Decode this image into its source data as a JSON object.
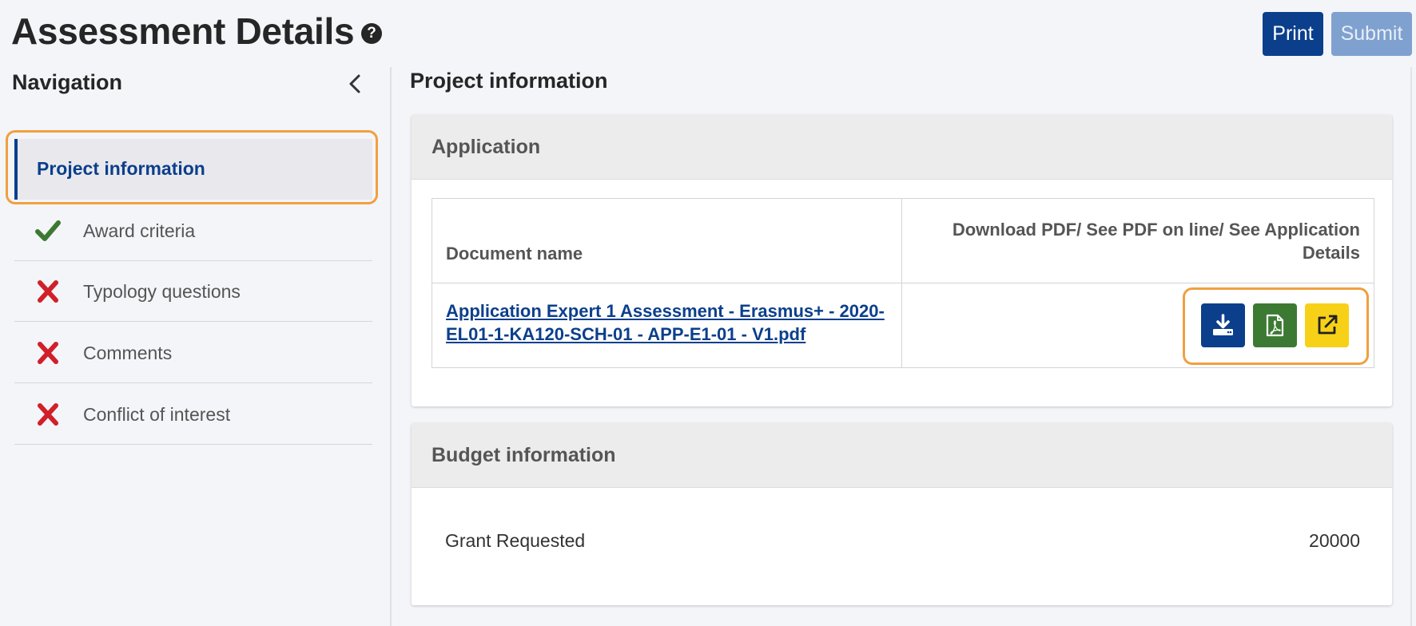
{
  "header": {
    "title": "Assessment Details",
    "print_label": "Print",
    "submit_label": "Submit"
  },
  "navigation": {
    "heading": "Navigation",
    "items": [
      {
        "label": "Project information",
        "status": "active"
      },
      {
        "label": "Award criteria",
        "status": "complete"
      },
      {
        "label": "Typology questions",
        "status": "incomplete"
      },
      {
        "label": "Comments",
        "status": "incomplete"
      },
      {
        "label": "Conflict of interest",
        "status": "incomplete"
      }
    ]
  },
  "main": {
    "section_title": "Project information",
    "application": {
      "header": "Application",
      "col_document": "Document name",
      "col_actions": "Download PDF/ See PDF on line/ See Application Details",
      "document_name": "Application Expert 1 Assessment - Erasmus+ - 2020-EL01-1-KA120-SCH-01 - APP-E1-01 - V1.pdf",
      "actions": [
        {
          "icon": "download-icon",
          "color": "#0b3f8c"
        },
        {
          "icon": "pdf-icon",
          "color": "#3c7a33"
        },
        {
          "icon": "external-link-icon",
          "color": "#f7d117"
        }
      ]
    },
    "budget": {
      "header": "Budget information",
      "grant_label": "Grant Requested",
      "grant_value": "20000"
    }
  },
  "colors": {
    "primary": "#0b3f8c",
    "highlight": "#f0a040",
    "success": "#3c7a33",
    "error": "#d0202a",
    "warning": "#f7d117"
  }
}
